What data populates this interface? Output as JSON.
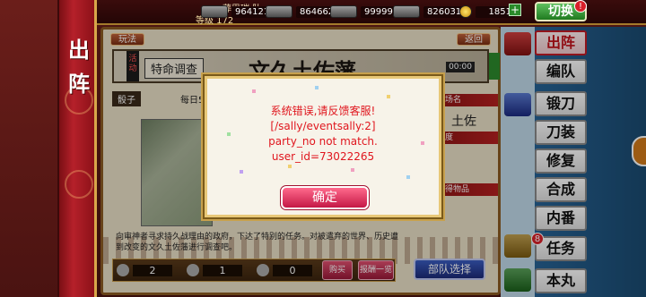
{
  "left_banner": {
    "title": [
      "出",
      "阵"
    ]
  },
  "top_bar": {
    "player_name": "葬思瑞 队",
    "level_label": "等级 172",
    "resources": [
      {
        "icon": "charcoal-icon",
        "value": "964121"
      },
      {
        "icon": "steel-icon",
        "value": "864662"
      },
      {
        "icon": "cooling-material-icon",
        "value": "999999"
      },
      {
        "icon": "whetstone-icon",
        "value": "826031"
      },
      {
        "icon": "coin-icon",
        "value": "1851"
      }
    ],
    "plus_label": "+",
    "switch_label": "切换",
    "switch_badge": "!"
  },
  "main": {
    "tab_left": "玩法",
    "tab_right": "返回",
    "event_side": "活动",
    "event_tag": "特命调查",
    "event_title": "文久土佐藩",
    "event_timer": "00:00",
    "dice_label": "骰子",
    "daily_label": "每日5",
    "stage_name": "土佐",
    "info_headers": [
      "战场名",
      "难度",
      "获得物品"
    ],
    "description": "向审神者寻求持久战理由的政府，下达了特别的任务。对被遣弃的世界、历史遭到改变的文久土佐藩进行调查吧。",
    "counts": [
      "2",
      "1",
      "0"
    ],
    "buy_label": "购买",
    "reward_label": "报酬一览",
    "team_select_label": "部队选择"
  },
  "nav": {
    "items": [
      "出阵",
      "编队",
      "锻刀",
      "刀装",
      "修复",
      "合成",
      "内番",
      "任务",
      "本丸"
    ],
    "task_badge": "8"
  },
  "modal": {
    "lines": [
      "系统错误,请反馈客服!",
      "[/sally/eventsally:2]",
      "party_no not match.",
      "user_id=73022265"
    ],
    "ok_label": "确定"
  },
  "colors": {
    "error_text": "#e0161e",
    "ok_button": "#c41846",
    "active_nav": "#c0101a"
  }
}
